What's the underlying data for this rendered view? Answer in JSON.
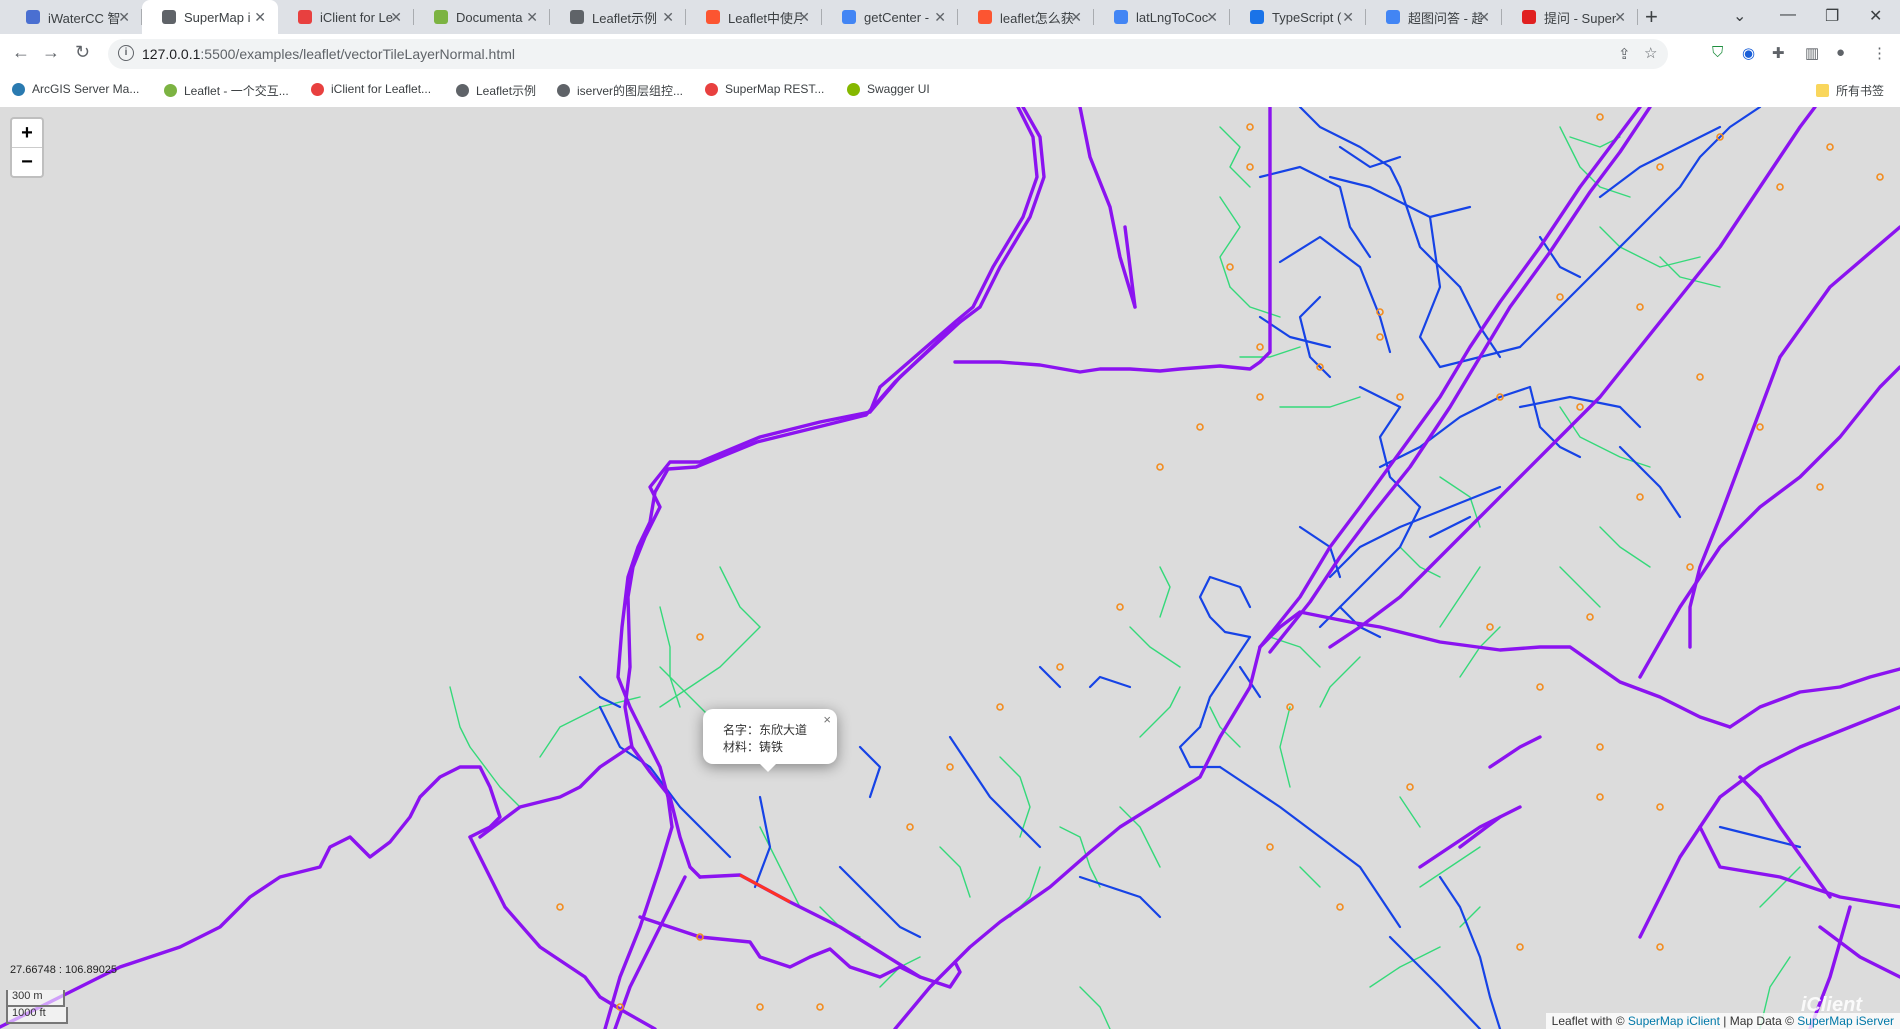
{
  "browser": {
    "tabs": [
      {
        "title": "iWaterCC 智",
        "icon": "page-icon",
        "color": "#4a6fd1"
      },
      {
        "title": "SuperMap i",
        "icon": "globe-icon",
        "color": "#5f6368",
        "active": true
      },
      {
        "title": "iClient for Le",
        "icon": "supermap-icon",
        "color": "#e8403f"
      },
      {
        "title": "Documenta",
        "icon": "leaflet-icon",
        "color": "#7cb342"
      },
      {
        "title": "Leaflet示例",
        "icon": "globe-icon",
        "color": "#5f6368"
      },
      {
        "title": "Leaflet中使月",
        "icon": "csdn-icon",
        "color": "#fc5531"
      },
      {
        "title": "getCenter -",
        "icon": "search-icon",
        "color": "#4285f4"
      },
      {
        "title": "leaflet怎么获",
        "icon": "csdn-icon",
        "color": "#fc5531"
      },
      {
        "title": "latLngToCoc",
        "icon": "search-icon",
        "color": "#4285f4"
      },
      {
        "title": "TypeScript (",
        "icon": "check-icon",
        "color": "#1a73e8"
      },
      {
        "title": "超图问答 - 超",
        "icon": "search-icon",
        "color": "#4285f4"
      },
      {
        "title": "提问 - Super",
        "icon": "supermap-s-icon",
        "color": "#e02020"
      }
    ],
    "url_host": "127.0.0.1",
    "url_rest": ":5500/examples/leaflet/vectorTileLayerNormal.html",
    "bookmarks": [
      {
        "label": "ArcGIS Server Ma...",
        "color": "#2a7ab0"
      },
      {
        "label": "Leaflet - 一个交互...",
        "color": "#7cb342"
      },
      {
        "label": "iClient for Leaflet...",
        "color": "#e8403f"
      },
      {
        "label": "Leaflet示例",
        "color": "#5f6368"
      },
      {
        "label": "iserver的图层组控...",
        "color": "#5f6368"
      },
      {
        "label": "SuperMap REST...",
        "color": "#e8403f"
      },
      {
        "label": "Swagger UI",
        "color": "#85b800"
      }
    ],
    "all_bookmarks": "所有书签"
  },
  "map": {
    "zoom_in": "+",
    "zoom_out": "−",
    "popup": {
      "name_line": "名字：东欣大道",
      "material_line": "材料：铸铁",
      "close": "×"
    },
    "mouse_position": "27.66748 : 106.89025",
    "scale_metric": "300 m",
    "scale_imperial": "1000 ft",
    "attribution": {
      "prefix": "Leaflet with ©",
      "client": "SuperMap iClient",
      "mid": "| Map Data ©",
      "server": "SuperMap iServer"
    },
    "watermark": "iClient",
    "colors": {
      "background": "#dcdcdc",
      "main_pipe": "#8b13f0",
      "secondary_pipe": "#1643e6",
      "branch_pipe": "#35d97a",
      "node": "#f28c1e",
      "highlight": "#ff3322"
    }
  }
}
